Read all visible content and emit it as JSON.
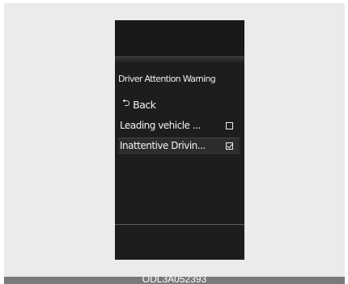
{
  "screen": {
    "title": "Driver Attention Warning",
    "back": {
      "icon": "back-arrow-icon",
      "label": "Back"
    },
    "items": [
      {
        "label": "Leading vehicle ...",
        "checked": false
      },
      {
        "label": "Inattentive Drivin...",
        "checked": true
      }
    ]
  },
  "caption": "ODL3A052393",
  "colors": {
    "screen_background": "#1d1d1d",
    "text": "#ececec",
    "frame_background": "#ebebeb"
  }
}
